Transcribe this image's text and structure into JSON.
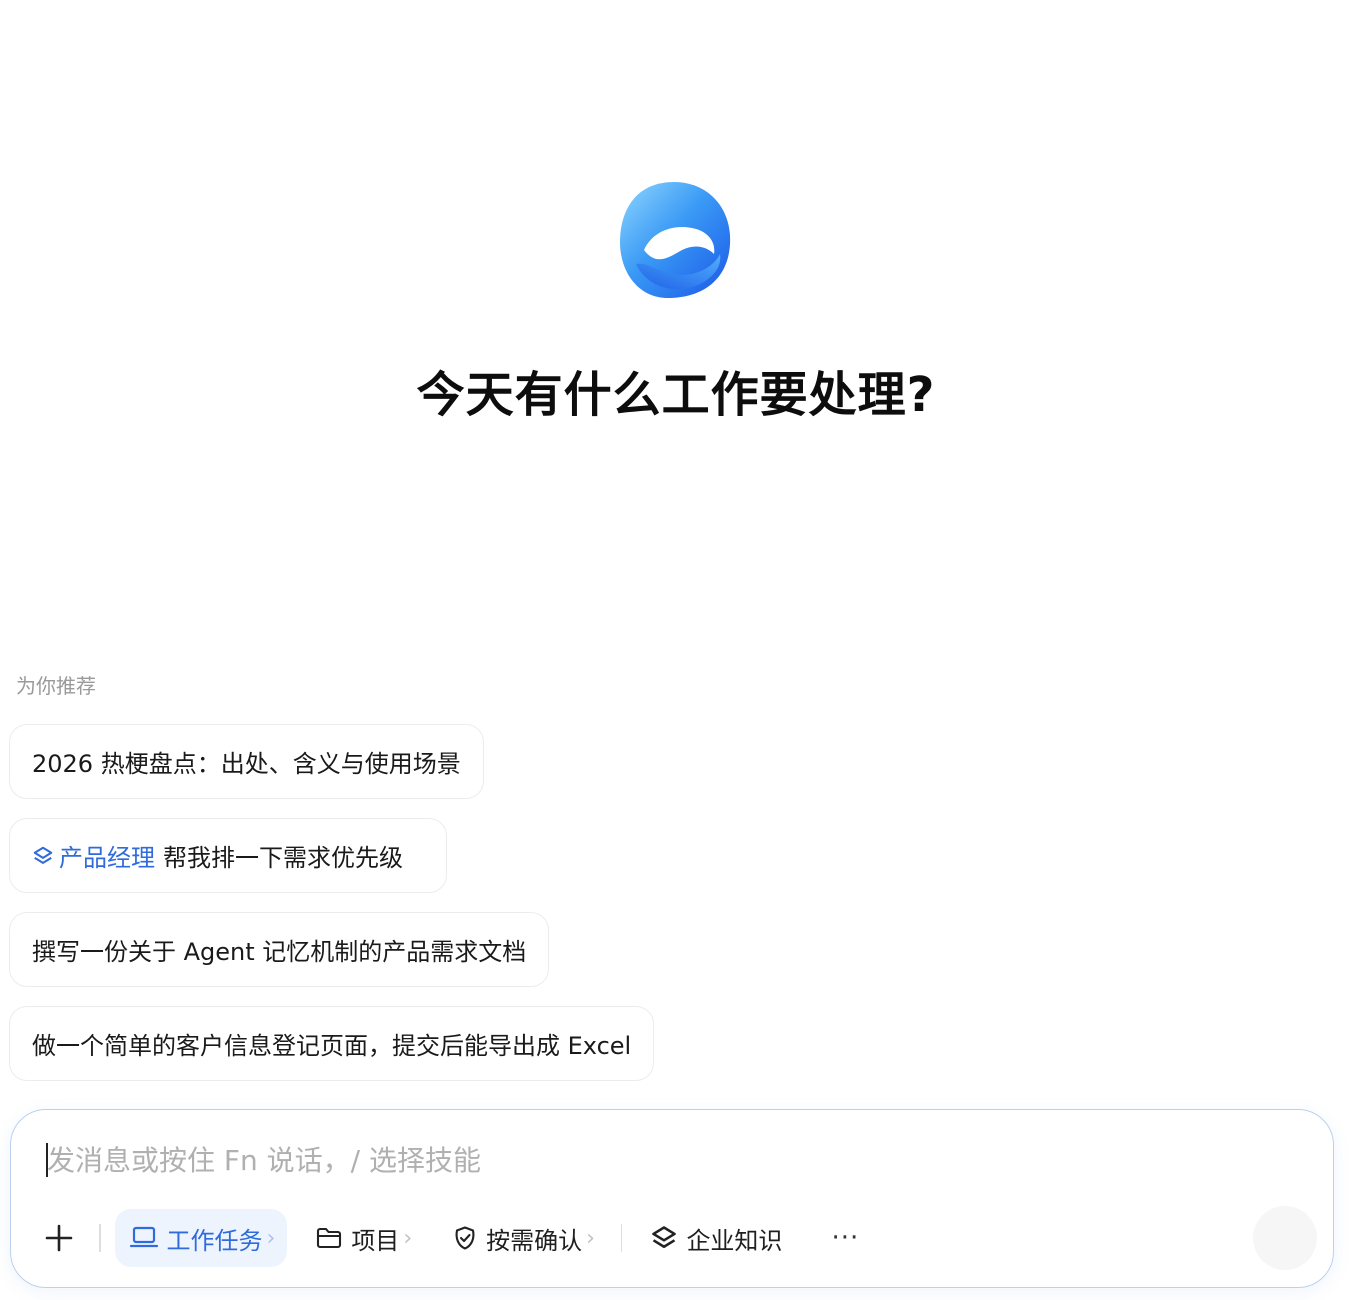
{
  "hero": {
    "logo_icon": "ribbon-logo-icon",
    "headline": "今天有什么工作要处理?"
  },
  "recommendations": {
    "title": "为你推荐",
    "items": [
      {
        "role": "",
        "text": "2026 热梗盘点：出处、含义与使用场景"
      },
      {
        "role": "产品经理",
        "text": "帮我排一下需求优先级"
      },
      {
        "role": "",
        "text": "撰写一份关于 Agent 记忆机制的产品需求文档"
      },
      {
        "role": "",
        "text": "做一个简单的客户信息登记页面，提交后能导出成 Excel"
      }
    ]
  },
  "composer": {
    "placeholder": "发消息或按住 Fn 说话，/ 选择技能",
    "value": "",
    "toolbar": {
      "plus_icon": "plus-icon",
      "work_task": {
        "label": "工作任务",
        "chevron": "›",
        "icon": "laptop-icon"
      },
      "project": {
        "label": "项目",
        "chevron": "›",
        "icon": "folder-icon"
      },
      "confirm": {
        "label": "按需确认",
        "chevron": "›",
        "icon": "check-circle-icon"
      },
      "knowledge": {
        "label": "企业知识",
        "icon": "layers-icon"
      },
      "more": "···"
    }
  },
  "colors": {
    "accent": "#2f6bdc",
    "active_bg": "#eef4fe",
    "border": "#bcd0f3"
  }
}
